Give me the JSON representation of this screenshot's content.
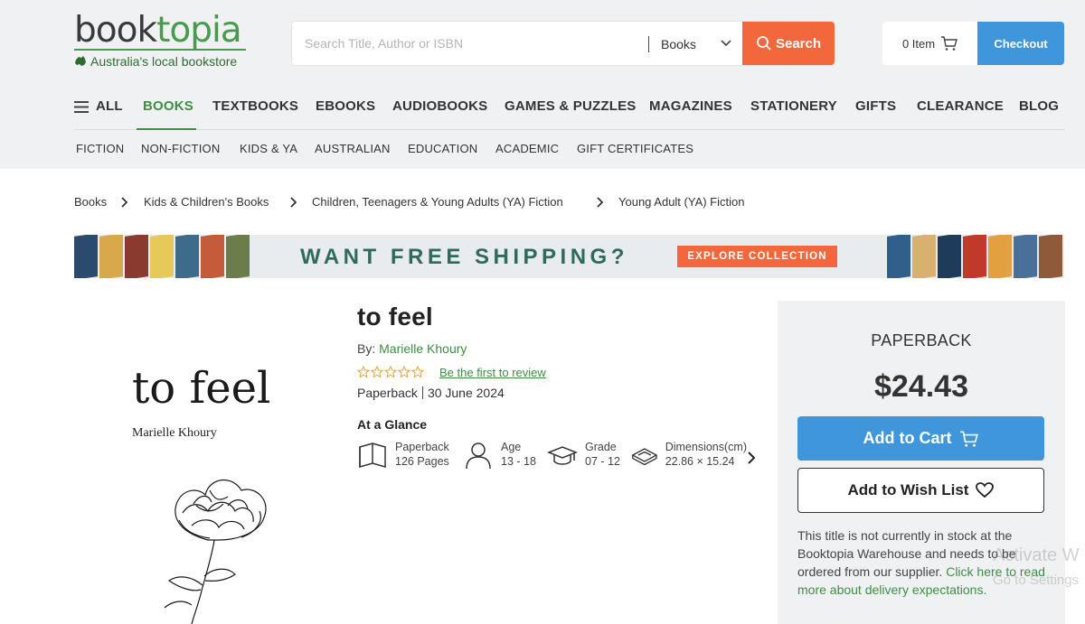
{
  "header": {
    "logo": {
      "part1": "book",
      "part2": "topia",
      "tagline": "Australia's local bookstore"
    },
    "search": {
      "placeholder": "Search Title, Author or ISBN",
      "category": "Books",
      "button_label": "Search"
    },
    "cart": {
      "label": "0 Item"
    },
    "checkout_label": "Checkout"
  },
  "nav": {
    "items": [
      "ALL",
      "BOOKS",
      "TEXTBOOKS",
      "EBOOKS",
      "AUDIOBOOKS",
      "GAMES & PUZZLES",
      "MAGAZINES",
      "STATIONERY",
      "GIFTS",
      "CLEARANCE",
      "BLOG"
    ],
    "active": "BOOKS"
  },
  "subnav": {
    "items": [
      "FICTION",
      "NON-FICTION",
      "KIDS & YA",
      "AUSTRALIAN",
      "EDUCATION",
      "ACADEMIC",
      "GIFT CERTIFICATES"
    ]
  },
  "breadcrumb": [
    "Books",
    "Kids & Children's Books",
    "Children, Teenagers & Young Adults (YA) Fiction",
    "Young Adult (YA) Fiction"
  ],
  "banner": {
    "text": "WANT FREE SHIPPING?",
    "button": "EXPLORE COLLECTION"
  },
  "cover": {
    "title": "to feel",
    "author": "Marielle Khoury"
  },
  "product": {
    "title": "to feel",
    "by_label": "By:",
    "author": "Marielle Khoury",
    "rating_stars": 0,
    "review_link": "Be the first to review",
    "format": "Paperback",
    "date": "30 June 2024",
    "glance_heading": "At a Glance",
    "glance": [
      {
        "icon": "book-icon",
        "line1": "Paperback",
        "line2": "126 Pages"
      },
      {
        "icon": "person-icon",
        "line1": "Age",
        "line2": "13 - 18"
      },
      {
        "icon": "graduation-cap-icon",
        "line1": "Grade",
        "line2": "07 - 12"
      },
      {
        "icon": "dimensions-icon",
        "line1": "Dimensions(cm)",
        "line2": "22.86 × 15.24"
      }
    ]
  },
  "panel": {
    "format": "PAPERBACK",
    "price": "$24.43",
    "add_to_cart": "Add to Cart",
    "add_to_wishlist": "Add to Wish List",
    "stock_text": "This title is not currently in stock at the Booktopia Warehouse and needs to be ordered from our supplier.",
    "stock_link": "Click here to read more about delivery expectations."
  },
  "watermark": {
    "line1": "Activate W",
    "line2": "Go to Settings"
  },
  "colors": {
    "brand_green": "#3e8e43",
    "accent_orange": "#f2683c",
    "button_blue": "#3f96da"
  }
}
